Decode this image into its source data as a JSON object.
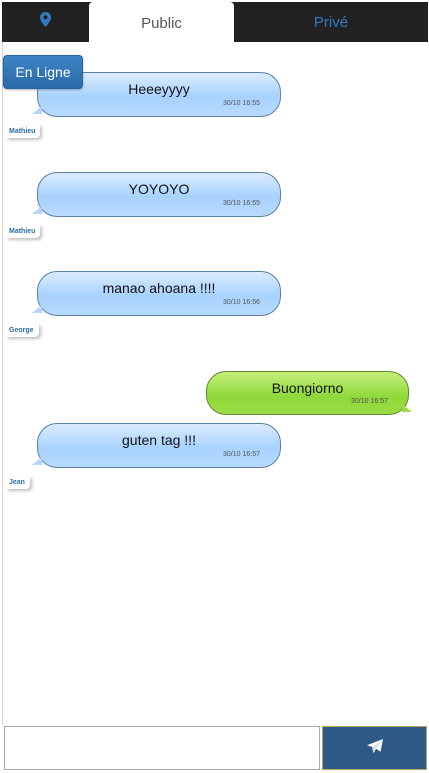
{
  "nav": {
    "location_icon": "map-marker-icon",
    "tab_public": "Public",
    "tab_prive": "Privé",
    "accent_color": "#3379c1"
  },
  "online_button": "En Ligne",
  "messages": [
    {
      "text": "Heeeyyyy",
      "time": "30/10 16:55",
      "sender": "Mathieu",
      "side": "left"
    },
    {
      "text": "YOYOYO",
      "time": "30/10 16:55",
      "sender": "Mathieu",
      "side": "left"
    },
    {
      "text": "manao ahoana !!!!",
      "time": "30/10 16:56",
      "sender": "George",
      "side": "left"
    },
    {
      "text": "Buongiorno",
      "time": "30/10 16:57",
      "sender": "",
      "side": "right"
    },
    {
      "text": "guten tag !!!",
      "time": "30/10 16:57",
      "sender": "Jean",
      "side": "left"
    }
  ],
  "composer": {
    "input_value": "",
    "input_placeholder": "",
    "send_icon": "paper-plane-icon"
  }
}
